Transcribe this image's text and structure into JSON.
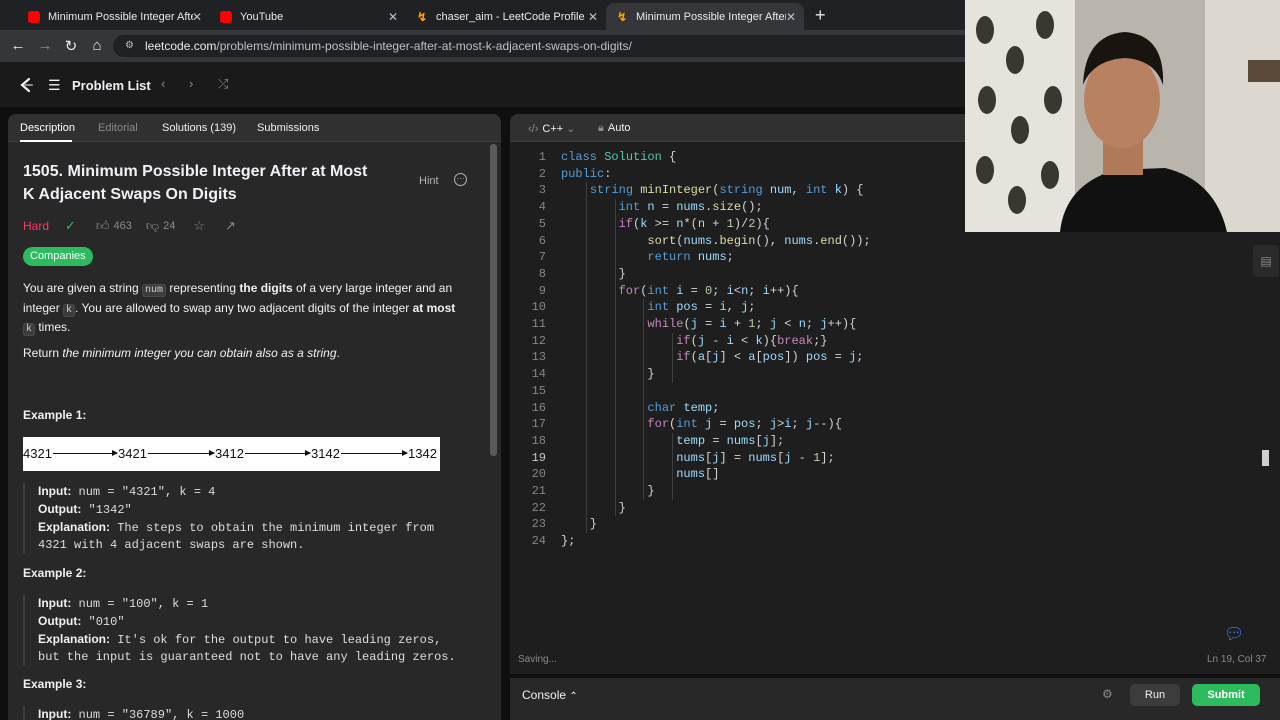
{
  "browser": {
    "tabs": [
      {
        "title": "Minimum Possible Integer After a",
        "favicon": "youtube-icon",
        "active": false
      },
      {
        "title": "YouTube",
        "favicon": "youtube-icon",
        "active": false
      },
      {
        "title": "chaser_aim - LeetCode Profile",
        "favicon": "leetcode-icon",
        "active": false
      },
      {
        "title": "Minimum Possible Integer After a",
        "favicon": "leetcode-icon",
        "active": true
      }
    ],
    "url_host": "leetcode.com",
    "url_path": "/problems/minimum-possible-integer-after-at-most-k-adjacent-swaps-on-digits/"
  },
  "header": {
    "problem_list_label": "Problem List"
  },
  "left_tabs": [
    "Description",
    "Editorial",
    "Solutions (139)",
    "Submissions"
  ],
  "problem": {
    "title": "1505. Minimum Possible Integer After at Most K Adjacent Swaps On Digits",
    "hint_label": "Hint",
    "difficulty": "Hard",
    "likes": "463",
    "dislikes": "24",
    "companies_label": "Companies",
    "desc_p1": [
      "You are given a string ",
      "num",
      " representing ",
      "the digits",
      " of a very large integer and an integer ",
      "k",
      ". You are allowed to swap any two adjacent digits of the integer ",
      "at most",
      " ",
      "k",
      " times."
    ],
    "desc_p2_prefix": "Return ",
    "desc_p2_italic": "the minimum integer you can obtain also as a string",
    "desc_p2_suffix": ".",
    "example1_heading": "Example 1:",
    "example1_diagram": [
      "4321",
      "3421",
      "3412",
      "3142",
      "1342"
    ],
    "example1": {
      "input_label": "Input:",
      "input": "num = \"4321\", k = 4",
      "output_label": "Output:",
      "output": "\"1342\"",
      "explanation_label": "Explanation:",
      "explanation": "The steps to obtain the minimum integer from 4321 with 4 adjacent swaps are shown."
    },
    "example2_heading": "Example 2:",
    "example2": {
      "input_label": "Input:",
      "input": "num = \"100\", k = 1",
      "output_label": "Output:",
      "output": "\"010\"",
      "explanation_label": "Explanation:",
      "explanation": "It's ok for the output to have leading zeros, but the input is guaranteed not to have any leading zeros."
    },
    "example3_heading": "Example 3:",
    "example3_input_partial": "num = \"36789\", k = 1000"
  },
  "editor": {
    "language": "C++",
    "mode": "Auto",
    "cursor_line": 19,
    "code_lines": [
      "class Solution {",
      "public:",
      "    string minInteger(string num, int k) {",
      "        int n = nums.size();",
      "        if(k >= n*(n + 1)/2){",
      "            sort(nums.begin(), nums.end());",
      "            return nums;",
      "        }",
      "        for(int i = 0; i<n; i++){",
      "            int pos = i, j;",
      "            while(j = i + 1; j < n; j++){",
      "                if(j - i < k){break;}",
      "                if(a[j] < a[pos]) pos = j;",
      "            }",
      "",
      "            char temp;",
      "            for(int j = pos; j>i; j--){",
      "                temp = nums[j];",
      "                nums[j] = nums[j - 1];",
      "                nums[]",
      "            }",
      "        }",
      "    }",
      "};"
    ],
    "status_left": "Saving...",
    "status_right": "Ln 19, Col 37"
  },
  "bottom": {
    "console_label": "Console",
    "run_label": "Run",
    "submit_label": "Submit"
  },
  "colors": {
    "keyword": "#569cd6",
    "type": "#4ec9b0",
    "function": "#dcdcaa",
    "variable": "#9cdcfe",
    "control": "#c586c0",
    "number": "#b5cea8",
    "hard": "#ff375f",
    "accent_green": "#2cbb5d"
  }
}
